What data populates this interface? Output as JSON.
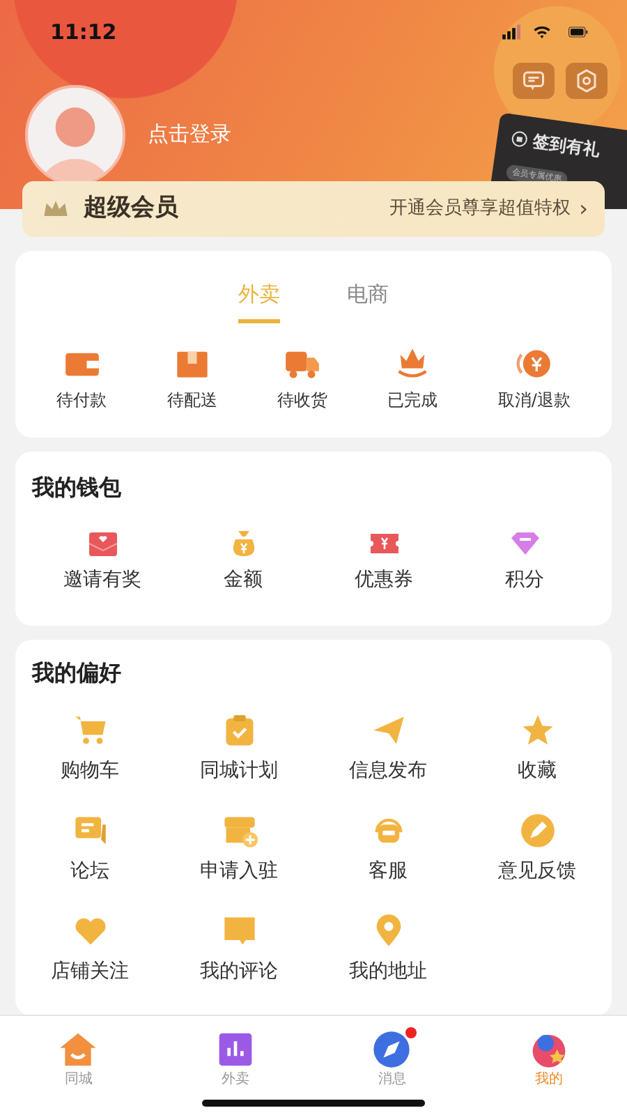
{
  "status_bar": {
    "time": "11:12"
  },
  "profile": {
    "login_text": "点击登录"
  },
  "checkin_card": {
    "title": "签到有礼",
    "subtitle": "会员专属优惠"
  },
  "vip_bar": {
    "title": "超级会员",
    "promo": "开通会员尊享超值特权",
    "arrow": "›"
  },
  "order_tabs": [
    {
      "label": "外卖",
      "selected": true
    },
    {
      "label": "电商",
      "selected": false
    }
  ],
  "order_items": [
    {
      "label": "待付款"
    },
    {
      "label": "待配送"
    },
    {
      "label": "待收货"
    },
    {
      "label": "已完成"
    },
    {
      "label": "取消/退款"
    }
  ],
  "wallet": {
    "title": "我的钱包",
    "items": [
      {
        "label": "邀请有奖"
      },
      {
        "label": "金额"
      },
      {
        "label": "优惠券"
      },
      {
        "label": "积分"
      }
    ]
  },
  "preferences": {
    "title": "我的偏好",
    "items": [
      {
        "label": "购物车"
      },
      {
        "label": "同城计划"
      },
      {
        "label": "信息发布"
      },
      {
        "label": "收藏"
      },
      {
        "label": "论坛"
      },
      {
        "label": "申请入驻"
      },
      {
        "label": "客服"
      },
      {
        "label": "意见反馈"
      },
      {
        "label": "店铺关注"
      },
      {
        "label": "我的评论"
      },
      {
        "label": "我的地址"
      }
    ]
  },
  "tab_bar": [
    {
      "label": "同城",
      "selected": false,
      "has_dot": false
    },
    {
      "label": "外卖",
      "selected": false,
      "has_dot": false
    },
    {
      "label": "消息",
      "selected": false,
      "has_dot": true
    },
    {
      "label": "我的",
      "selected": true,
      "has_dot": false
    }
  ]
}
